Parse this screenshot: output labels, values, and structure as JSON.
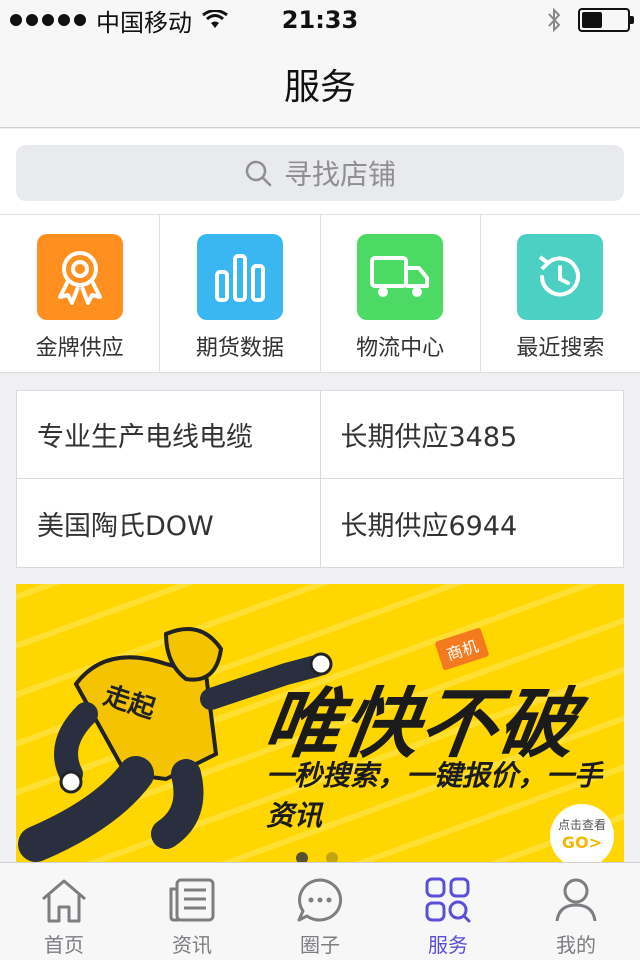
{
  "status_bar": {
    "carrier": "中国移动",
    "time": "21:33",
    "battery_level": 0.45
  },
  "nav": {
    "title": "服务"
  },
  "search": {
    "placeholder": "寻找店铺"
  },
  "quick_items": [
    {
      "label": "金牌供应",
      "icon": "medal-icon",
      "color": "#ff8f1f"
    },
    {
      "label": "期货数据",
      "icon": "bar-chart-icon",
      "color": "#3ab6f0"
    },
    {
      "label": "物流中心",
      "icon": "truck-icon",
      "color": "#4cd964"
    },
    {
      "label": "最近搜索",
      "icon": "history-icon",
      "color": "#4dd0c4"
    }
  ],
  "info_rows": [
    [
      "专业生产电线电缆",
      "长期供应3485"
    ],
    [
      "美国陶氏DOW",
      "长期供应6944"
    ]
  ],
  "banner": {
    "tag": "商机",
    "headline": "唯快不破",
    "subline": "一秒搜索，一键报价，一手资讯",
    "figure_text": "走起",
    "go_top": "点击查看",
    "go_text": "GO>",
    "slides": 2,
    "active_slide": 0
  },
  "tabs": [
    {
      "label": "首页",
      "icon": "home-icon"
    },
    {
      "label": "资讯",
      "icon": "news-icon"
    },
    {
      "label": "圈子",
      "icon": "chat-icon"
    },
    {
      "label": "服务",
      "icon": "grid-search-icon",
      "active": true
    },
    {
      "label": "我的",
      "icon": "person-icon"
    }
  ],
  "colors": {
    "accent": "#5b4fd8",
    "banner_bg": "#ffd600"
  }
}
